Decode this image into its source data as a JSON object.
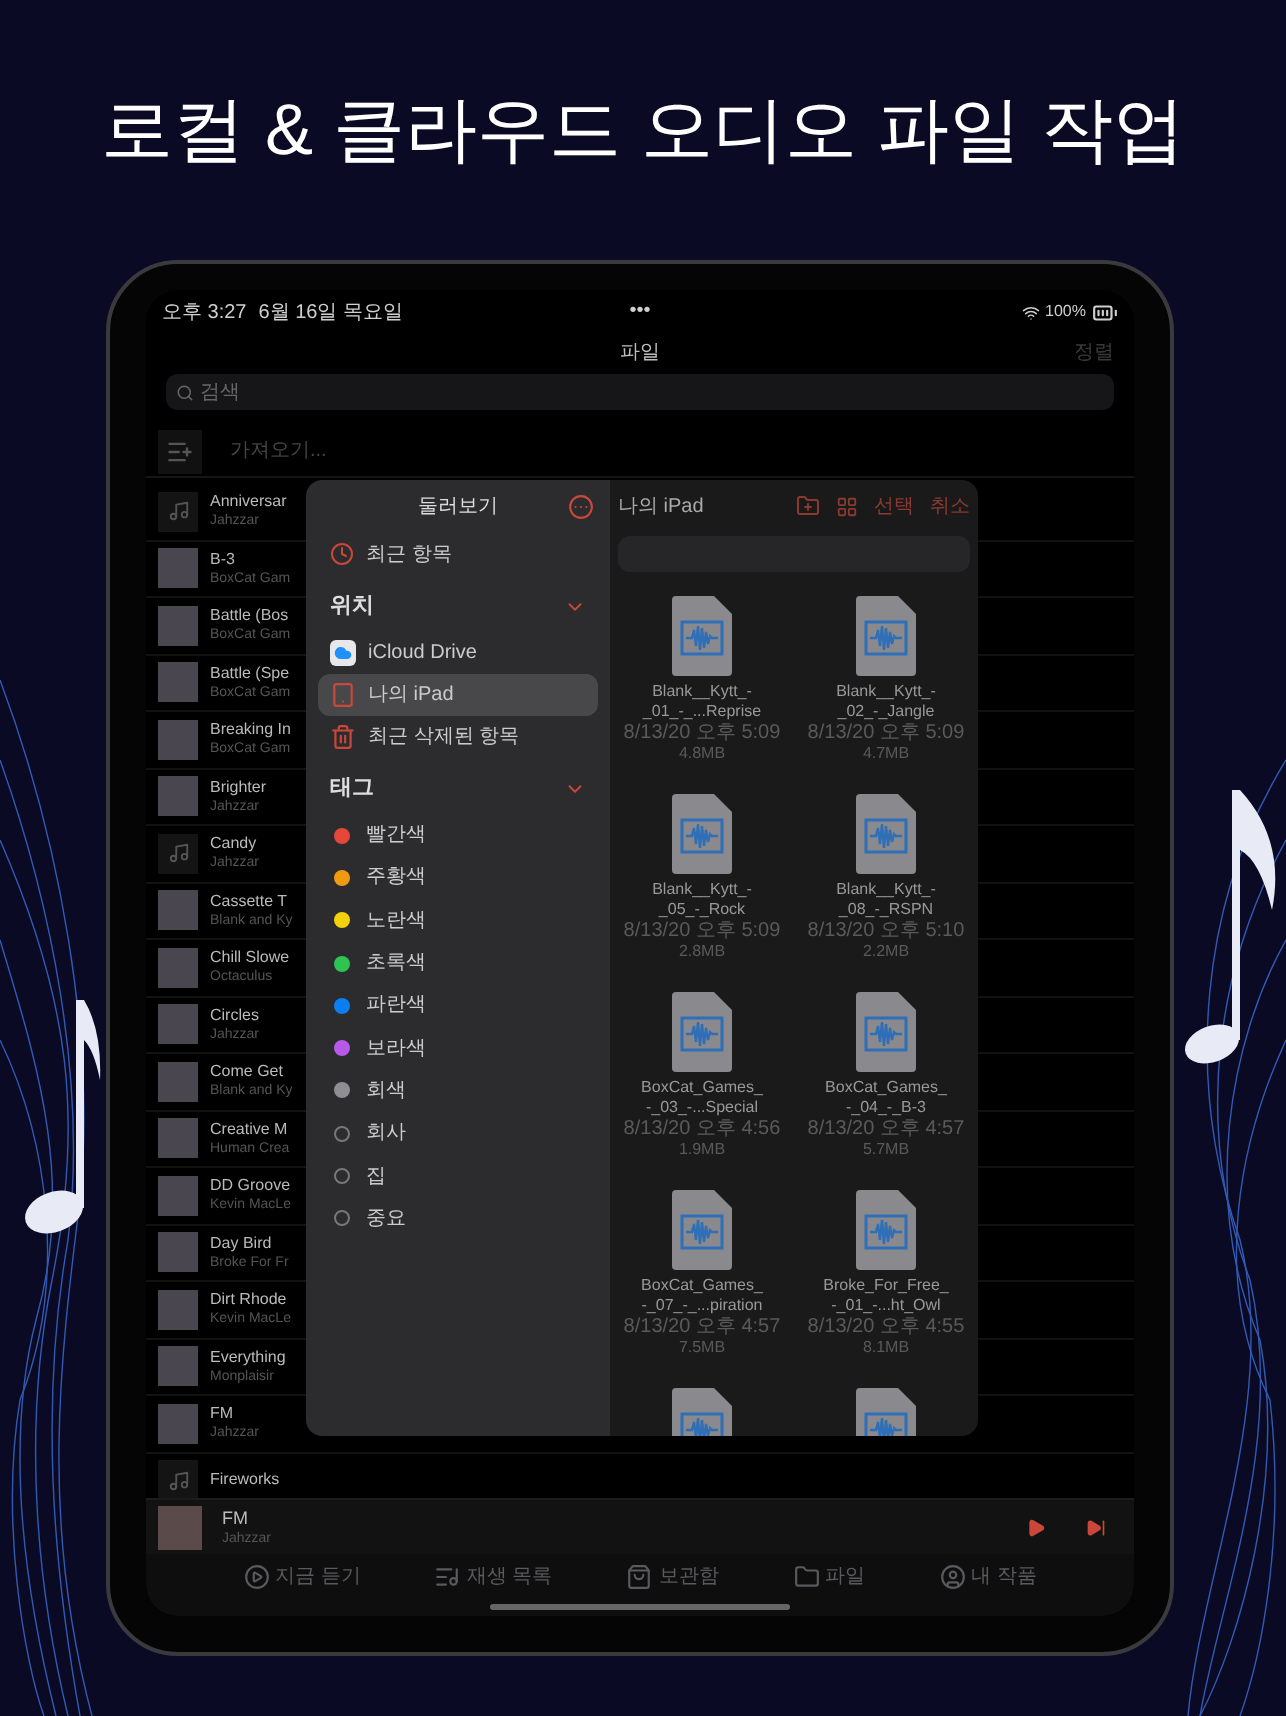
{
  "headline": "로컬 & 클라우드 오디오 파일 작업",
  "status_bar": {
    "time": "오후 3:27",
    "date": "6월 16일 목요일",
    "dots": "•••",
    "battery": "100%"
  },
  "nav": {
    "title": "파일",
    "action": "정렬"
  },
  "search": {
    "placeholder": "검색"
  },
  "import_row": {
    "label": "가져오기..."
  },
  "songs": [
    {
      "kind": "note",
      "title": "Anniversar",
      "artist": "Jahzzar"
    },
    {
      "kind": "photo",
      "title": "B-3",
      "artist": "BoxCat Gam"
    },
    {
      "kind": "photo",
      "title": "Battle (Bos",
      "artist": "BoxCat Gam"
    },
    {
      "kind": "photo",
      "title": "Battle (Spe",
      "artist": "BoxCat Gam"
    },
    {
      "kind": "photo",
      "title": "Breaking In",
      "artist": "BoxCat Gam"
    },
    {
      "kind": "photo",
      "title": "Brighter",
      "artist": "Jahzzar"
    },
    {
      "kind": "note",
      "title": "Candy",
      "artist": "Jahzzar"
    },
    {
      "kind": "photo",
      "title": "Cassette T",
      "artist": "Blank and Ky"
    },
    {
      "kind": "photo",
      "title": "Chill Slowe",
      "artist": "Octaculus"
    },
    {
      "kind": "photo",
      "title": "Circles",
      "artist": "Jahzzar"
    },
    {
      "kind": "photo",
      "title": "Come Get",
      "artist": "Blank and Ky"
    },
    {
      "kind": "photo",
      "title": "Creative M",
      "artist": "Human Crea"
    },
    {
      "kind": "photo",
      "title": "DD Groove",
      "artist": "Kevin MacLe"
    },
    {
      "kind": "photo",
      "title": "Day Bird",
      "artist": "Broke For Fr"
    },
    {
      "kind": "photo",
      "title": "Dirt Rhode",
      "artist": "Kevin MacLe"
    },
    {
      "kind": "photo",
      "title": "Everything",
      "artist": "Monplaisir"
    },
    {
      "kind": "photo",
      "title": "FM",
      "artist": "Jahzzar"
    },
    {
      "kind": "note",
      "title": "Fireworks"
    }
  ],
  "sidebar": {
    "title": "둘러보기",
    "recent": "최근 항목",
    "locations_header": {
      "label": "위치",
      "expanded": true
    },
    "locations": [
      {
        "kind": "icloud",
        "label": "iCloud Drive",
        "selected": false
      },
      {
        "kind": "ipad",
        "label": "나의 iPad",
        "selected": true
      },
      {
        "kind": "trash",
        "label": "최근 삭제된 항목",
        "selected": false
      }
    ],
    "tags_header": {
      "label": "태그",
      "expanded": true
    },
    "tags": [
      {
        "label": "빨간색",
        "color": "#e5483b"
      },
      {
        "label": "주황색",
        "color": "#f09a12"
      },
      {
        "label": "노란색",
        "color": "#f2d20e"
      },
      {
        "label": "초록색",
        "color": "#2fc452"
      },
      {
        "label": "파란색",
        "color": "#0a7ff0"
      },
      {
        "label": "보라색",
        "color": "#b85ae8"
      },
      {
        "label": "회색",
        "color": "#8e8e93"
      },
      {
        "label": "회사"
      },
      {
        "label": "집"
      },
      {
        "label": "중요"
      }
    ]
  },
  "browser": {
    "title": "나의 iPad",
    "select": "선택",
    "cancel": "취소",
    "files": [
      {
        "kind": "file",
        "name": [
          "Blank__Kytt_-",
          "_01_-_...Reprise"
        ],
        "date": "8/13/20 오후 5:09",
        "size": "4.8MB"
      },
      {
        "kind": "file",
        "name": [
          "Blank__Kytt_-",
          "_02_-_Jangle"
        ],
        "date": "8/13/20 오후 5:09",
        "size": "4.7MB"
      },
      {
        "kind": "file",
        "name": [
          "Blank__Kytt_-",
          "_05_-_Rock"
        ],
        "date": "8/13/20 오후 5:09",
        "size": "2.8MB"
      },
      {
        "kind": "file",
        "name": [
          "Blank__Kytt_-",
          "_08_-_RSPN"
        ],
        "date": "8/13/20 오후 5:10",
        "size": "2.2MB"
      },
      {
        "kind": "file",
        "name": [
          "BoxCat_Games_",
          "-_03_-...Special"
        ],
        "date": "8/13/20 오후 4:56",
        "size": "1.9MB"
      },
      {
        "kind": "file",
        "name": [
          "BoxCat_Games_",
          "-_04_-_B-3"
        ],
        "date": "8/13/20 오후 4:57",
        "size": "5.7MB"
      },
      {
        "kind": "file",
        "name": [
          "BoxCat_Games_",
          "-_07_-_...piration"
        ],
        "date": "8/13/20 오후 4:57",
        "size": "7.5MB"
      },
      {
        "kind": "file",
        "name": [
          "Broke_For_Free_",
          "-_01_-...ht_Owl"
        ],
        "date": "8/13/20 오후 4:55",
        "size": "8.1MB"
      },
      {
        "kind": "cut"
      },
      {
        "kind": "cut"
      }
    ]
  },
  "player": {
    "title": "FM",
    "artist": "Jahzzar"
  },
  "tabs": [
    {
      "kind": "now",
      "label": "지금 듣기"
    },
    {
      "kind": "playlist",
      "label": "재생 목록"
    },
    {
      "kind": "library",
      "label": "보관함"
    },
    {
      "kind": "files",
      "label": "파일"
    },
    {
      "kind": "profile",
      "label": "내 작품"
    }
  ]
}
